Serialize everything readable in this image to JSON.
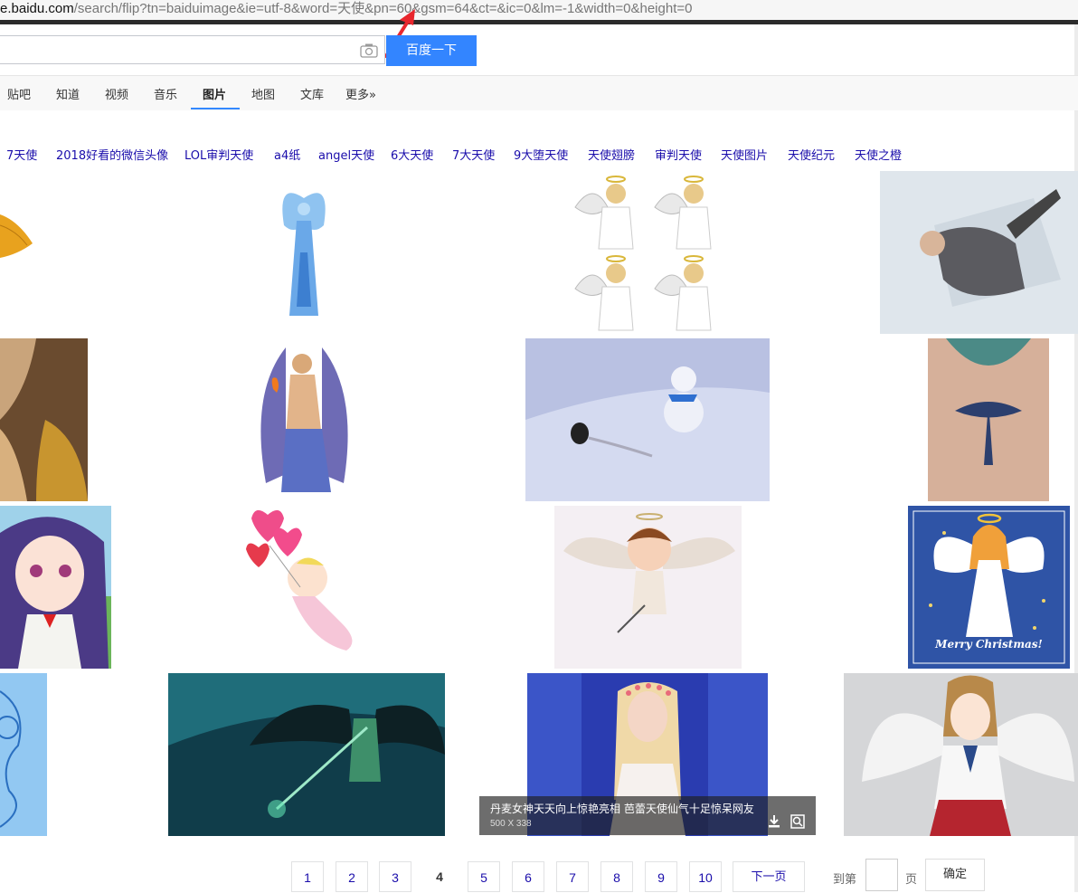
{
  "address_bar": {
    "host": "e.baidu.com",
    "path": "/search/flip?tn=baiduimage&ie=utf-8&word=天使&pn=60&gsm=64&ct=&ic=0&lm=-1&width=0&height=0"
  },
  "search": {
    "button_label": "百度一下"
  },
  "nav": {
    "items": [
      "贴吧",
      "知道",
      "视频",
      "音乐",
      "图片",
      "地图",
      "文库",
      "更多»"
    ],
    "active": "图片"
  },
  "related_searches": [
    "7天使",
    "2018好看的微信头像",
    "LOL审判天使",
    "a4纸",
    "angel天使",
    "6大天使",
    "7大天使",
    "9大堕天使",
    "天使翅膀",
    "审判天使",
    "天使图片",
    "天使纪元",
    "天使之橙"
  ],
  "hover_card": {
    "caption": "丹麦女神天天向上惊艳亮相 芭蕾天使仙气十足惊呆网友",
    "dimensions": "500 X 338"
  },
  "tile_text": {
    "merry_christmas": "Merry Christmas!"
  },
  "pagination": {
    "pages": [
      "1",
      "2",
      "3",
      "4",
      "5",
      "6",
      "7",
      "8",
      "9",
      "10"
    ],
    "current": "4",
    "next_label": "下一页",
    "jump_prefix": "到第",
    "jump_suffix": "页",
    "confirm_label": "确定"
  },
  "colors": {
    "accent": "#3385ff",
    "link": "#1a0dab"
  }
}
